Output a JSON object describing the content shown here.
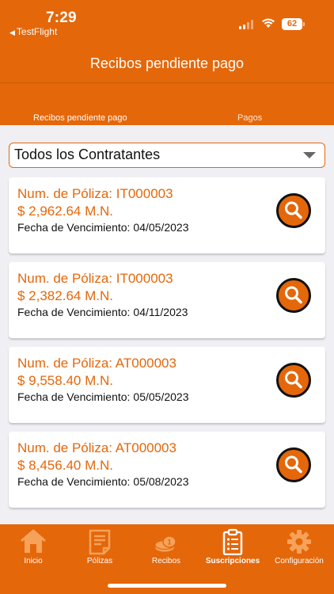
{
  "status_bar": {
    "time": "7:29",
    "back_app": "TestFlight",
    "battery": "62"
  },
  "header": {
    "title": "Recibos pendiente pago"
  },
  "tabs": [
    {
      "label": "Recibos pendiente pago",
      "active": true
    },
    {
      "label": "Pagos",
      "active": false
    }
  ],
  "filter": {
    "selected": "Todos los Contratantes"
  },
  "receipts": [
    {
      "policy": "Num. de Póliza: IT000003",
      "amount": "$ 2,962.64 M.N.",
      "due_label": "Fecha de Vencimiento:",
      "due_date": "04/05/2023"
    },
    {
      "policy": "Num. de Póliza: IT000003",
      "amount": "$ 2,382.64 M.N.",
      "due_label": "Fecha de Vencimiento:",
      "due_date": "04/11/2023"
    },
    {
      "policy": "Num. de Póliza: AT000003",
      "amount": "$ 9,558.40 M.N.",
      "due_label": "Fecha de Vencimiento:",
      "due_date": "05/05/2023"
    },
    {
      "policy": "Num. de Póliza: AT000003",
      "amount": "$ 8,456.40 M.N.",
      "due_label": "Fecha de Vencimiento:",
      "due_date": "05/08/2023"
    }
  ],
  "tabbar": [
    {
      "label": "Inicio",
      "icon": "home-icon"
    },
    {
      "label": "Pólizas",
      "icon": "document-icon"
    },
    {
      "label": "Recibos",
      "icon": "coins-icon"
    },
    {
      "label": "Suscripciones",
      "icon": "clipboard-icon",
      "active": true
    },
    {
      "label": "Configuración",
      "icon": "gear-icon"
    }
  ],
  "colors": {
    "accent": "#e4670a",
    "background": "#efeff4",
    "icon_inactive": "#f6a25a"
  }
}
